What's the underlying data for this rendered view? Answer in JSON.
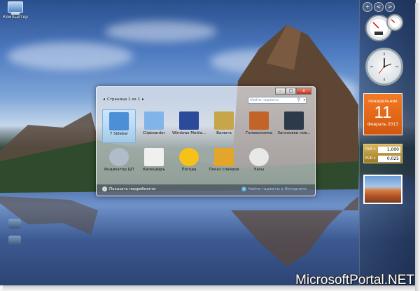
{
  "desktop": {
    "icon_label": "Компьютер",
    "watermark": "MicrosoftPortal.NET"
  },
  "sidebar": {
    "top_buttons": [
      "+",
      "<",
      ">"
    ],
    "calendar": {
      "weekday": "понедельник",
      "day": "11",
      "month_year": "Февраль 2013"
    },
    "currency": [
      {
        "name": "RUR",
        "value": "1,000"
      },
      {
        "name": "EUR",
        "value": "0,025"
      }
    ]
  },
  "gallery": {
    "page_label": "Страница 1 из 1",
    "search_placeholder": "Найти гаджеты",
    "window_controls": [
      "–",
      "□",
      "x"
    ],
    "gadgets": [
      {
        "label": "7 Sidebar",
        "icon": "sidebar-icon",
        "color": "#4d8fd6"
      },
      {
        "label": "Clipboarder",
        "icon": "clipboarder-icon",
        "color": "#7fb5e8"
      },
      {
        "label": "Windows Media...",
        "icon": "media-center-icon",
        "color": "#2b4a9a"
      },
      {
        "label": "Валюта",
        "icon": "currency-icon",
        "color": "#c7a54a"
      },
      {
        "label": "Головоломка",
        "icon": "puzzle-icon",
        "color": "#c2642a"
      },
      {
        "label": "Заголовки нов...",
        "icon": "news-icon",
        "color": "#2d3a4a"
      },
      {
        "label": "Индикатор ЦП",
        "icon": "cpu-meter-icon",
        "color": "#b0bcc8"
      },
      {
        "label": "Календарь",
        "icon": "calendar-icon",
        "color": "#f0f0f0"
      },
      {
        "label": "Погода",
        "icon": "weather-icon",
        "color": "#f6c21a"
      },
      {
        "label": "Показ слайдов",
        "icon": "slideshow-icon",
        "color": "#e2a62a"
      },
      {
        "label": "Часы",
        "icon": "clock-icon",
        "color": "#e8e8e8"
      }
    ],
    "details_label": "Показать подробности",
    "online_label": "Найти гаджеты в Интернете"
  }
}
